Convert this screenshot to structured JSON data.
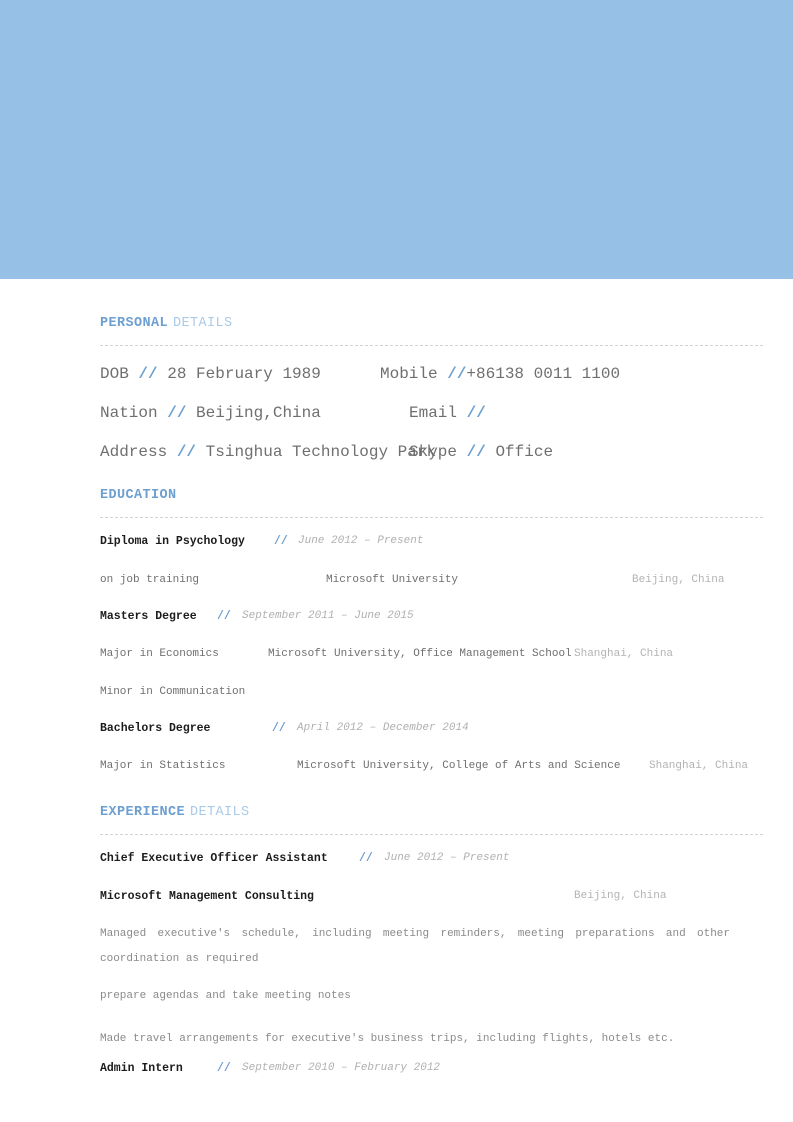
{
  "theme": {
    "banner_color": "#96c0e6",
    "heading_strong_color": "#6d9fd0",
    "heading_light_color": "#a9cae8",
    "accent_slash_color": "#6d9fd0",
    "body_text_color": "#6f6f6f",
    "muted_text_color": "#b3b3b3",
    "rule_color": "#d2d2d2"
  },
  "sections": {
    "personal": {
      "heading_strong": "PERSONAL",
      "heading_light": "DETAILS",
      "rows": [
        {
          "left_label": "DOB",
          "left_slash": "//",
          "left_value": "28 February 1989",
          "right_label": "Mobile",
          "right_slash": "//",
          "right_value": "+86138 0011 1100"
        },
        {
          "left_label": "Nation",
          "left_slash": "//",
          "left_value": "Beijing,China",
          "right_label": "Email",
          "right_slash": "//",
          "right_value": ""
        },
        {
          "left_label": "Address",
          "left_slash": "//",
          "left_value": "Tsinghua Technology Park",
          "right_label": "Skype",
          "right_slash": "//",
          "right_value": "Office"
        }
      ]
    },
    "education": {
      "heading_strong": "EDUCATION",
      "heading_light": "",
      "entries": [
        {
          "title": "Diploma in Psychology",
          "slash": "//",
          "date": "June 2012 – Present",
          "lines": [
            {
              "col_a": "on job training",
              "col_b": "Microsoft University",
              "col_c": "Beijing, China"
            }
          ]
        },
        {
          "title": "Masters Degree",
          "slash": "//",
          "date": "September 2011 – June 2015",
          "lines": [
            {
              "col_a": "Major in Economics",
              "col_b": "Microsoft University, Office Management School",
              "col_c": "Shanghai, China"
            },
            {
              "col_a": "Minor in Communication",
              "col_b": "",
              "col_c": ""
            }
          ]
        },
        {
          "title": "Bachelors Degree",
          "slash": "//",
          "date": "April 2012 – December 2014",
          "lines": [
            {
              "col_a": "Major in Statistics",
              "col_b": "Microsoft University, College of Arts and Science",
              "col_c": "Shanghai, China"
            }
          ]
        }
      ]
    },
    "experience": {
      "heading_strong": "EXPERIENCE",
      "heading_light": "DETAILS",
      "entries": [
        {
          "title": "Chief Executive Officer Assistant",
          "slash": "//",
          "date": "June 2012 – Present",
          "company": "Microsoft Management Consulting",
          "location": "Beijing, China",
          "bullets": [
            "Managed executive's schedule, including meeting reminders, meeting preparations and other coordination as required",
            "prepare agendas and take meeting notes",
            "Made travel arrangements for executive's business trips, including flights, hotels etc."
          ]
        },
        {
          "title": "Admin Intern",
          "slash": "//",
          "date": "September 2010 – February 2012",
          "company": "",
          "location": "",
          "bullets": []
        }
      ]
    }
  }
}
